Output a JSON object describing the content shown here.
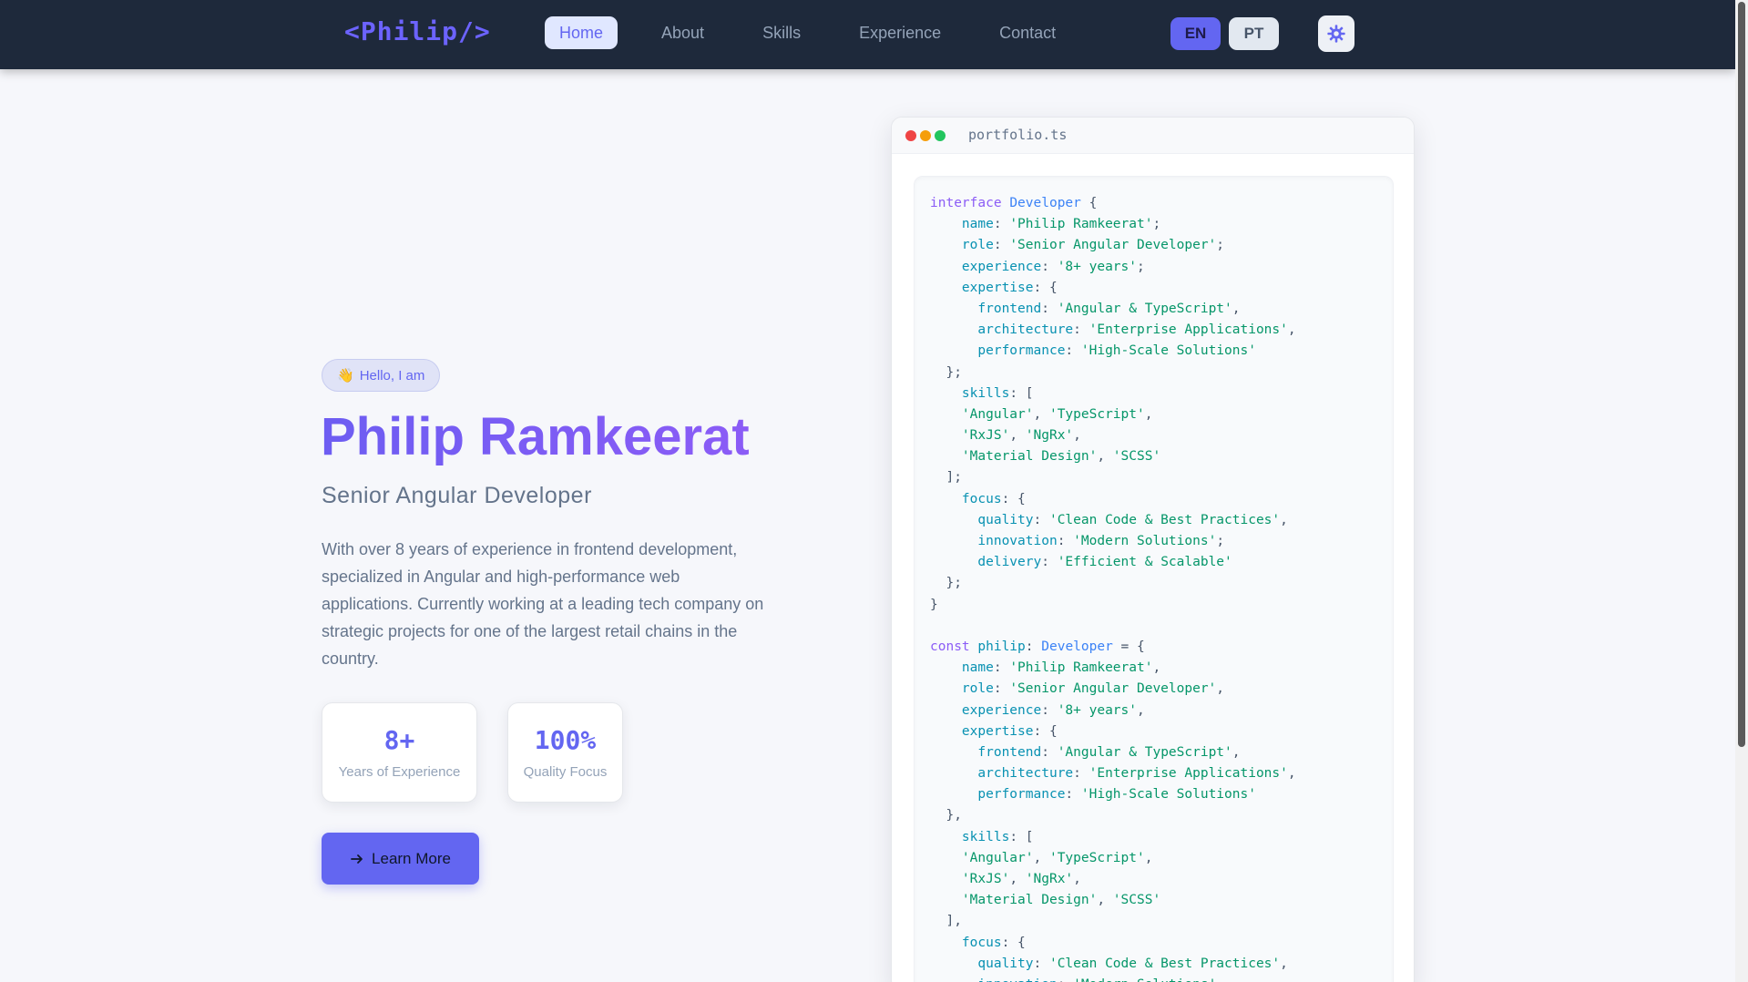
{
  "nav": {
    "logo": "<Philip/>",
    "links": [
      "Home",
      "About",
      "Skills",
      "Experience",
      "Contact"
    ],
    "lang_en": "EN",
    "lang_pt": "PT",
    "theme_icon": "gear-icon"
  },
  "hero": {
    "badge": "Hello, I am",
    "badge_icon": "👋",
    "name": "Philip Ramkeerat",
    "role": "Senior Angular Developer",
    "description": "With over 8 years of experience in frontend development, specialized in Angular and high-performance web applications. Currently working at a leading tech company on strategic projects for one of the largest retail chains in the country.",
    "stats": [
      {
        "value": "8+",
        "label": "Years of Experience"
      },
      {
        "value": "100%",
        "label": "Quality Focus"
      }
    ],
    "cta": "Learn More"
  },
  "code": {
    "filename": "portfolio.ts",
    "lines": [
      [
        [
          "kw",
          "interface "
        ],
        [
          "ty",
          "Developer"
        ],
        [
          "pn",
          " {"
        ]
      ],
      [
        [
          "pn",
          "    "
        ],
        [
          "pr",
          "name"
        ],
        [
          "pn",
          ": "
        ],
        [
          "st",
          "'Philip Ramkeerat'"
        ],
        [
          "pn",
          ";"
        ]
      ],
      [
        [
          "pn",
          "    "
        ],
        [
          "pr",
          "role"
        ],
        [
          "pn",
          ": "
        ],
        [
          "st",
          "'Senior Angular Developer'"
        ],
        [
          "pn",
          ";"
        ]
      ],
      [
        [
          "pn",
          "    "
        ],
        [
          "pr",
          "experience"
        ],
        [
          "pn",
          ": "
        ],
        [
          "st",
          "'8+ years'"
        ],
        [
          "pn",
          ";"
        ]
      ],
      [
        [
          "pn",
          "    "
        ],
        [
          "pr",
          "expertise"
        ],
        [
          "pn",
          ": {"
        ]
      ],
      [
        [
          "pn",
          "      "
        ],
        [
          "pr",
          "frontend"
        ],
        [
          "pn",
          ": "
        ],
        [
          "st",
          "'Angular & TypeScript'"
        ],
        [
          "pn",
          ","
        ]
      ],
      [
        [
          "pn",
          "      "
        ],
        [
          "pr",
          "architecture"
        ],
        [
          "pn",
          ": "
        ],
        [
          "st",
          "'Enterprise Applications'"
        ],
        [
          "pn",
          ","
        ]
      ],
      [
        [
          "pn",
          "      "
        ],
        [
          "pr",
          "performance"
        ],
        [
          "pn",
          ": "
        ],
        [
          "st",
          "'High-Scale Solutions'"
        ]
      ],
      [
        [
          "pn",
          "  };"
        ]
      ],
      [
        [
          "pn",
          "    "
        ],
        [
          "pr",
          "skills"
        ],
        [
          "pn",
          ": ["
        ]
      ],
      [
        [
          "pn",
          "    "
        ],
        [
          "st",
          "'Angular'"
        ],
        [
          "pn",
          ", "
        ],
        [
          "st",
          "'TypeScript'"
        ],
        [
          "pn",
          ","
        ]
      ],
      [
        [
          "pn",
          "    "
        ],
        [
          "st",
          "'RxJS'"
        ],
        [
          "pn",
          ", "
        ],
        [
          "st",
          "'NgRx'"
        ],
        [
          "pn",
          ","
        ]
      ],
      [
        [
          "pn",
          "    "
        ],
        [
          "st",
          "'Material Design'"
        ],
        [
          "pn",
          ", "
        ],
        [
          "st",
          "'SCSS'"
        ]
      ],
      [
        [
          "pn",
          "  ];"
        ]
      ],
      [
        [
          "pn",
          "    "
        ],
        [
          "pr",
          "focus"
        ],
        [
          "pn",
          ": {"
        ]
      ],
      [
        [
          "pn",
          "      "
        ],
        [
          "pr",
          "quality"
        ],
        [
          "pn",
          ": "
        ],
        [
          "st",
          "'Clean Code & Best Practices'"
        ],
        [
          "pn",
          ","
        ]
      ],
      [
        [
          "pn",
          "      "
        ],
        [
          "pr",
          "innovation"
        ],
        [
          "pn",
          ": "
        ],
        [
          "st",
          "'Modern Solutions'"
        ],
        [
          "pn",
          ";"
        ]
      ],
      [
        [
          "pn",
          "      "
        ],
        [
          "pr",
          "delivery"
        ],
        [
          "pn",
          ": "
        ],
        [
          "st",
          "'Efficient & Scalable'"
        ]
      ],
      [
        [
          "pn",
          "  };"
        ]
      ],
      [
        [
          "pn",
          "}"
        ]
      ],
      [],
      [
        [
          "kw",
          "const "
        ],
        [
          "pr",
          "philip"
        ],
        [
          "pn",
          ": "
        ],
        [
          "ty",
          "Developer"
        ],
        [
          "pn",
          " = {"
        ]
      ],
      [
        [
          "pn",
          "    "
        ],
        [
          "pr",
          "name"
        ],
        [
          "pn",
          ": "
        ],
        [
          "st",
          "'Philip Ramkeerat'"
        ],
        [
          "pn",
          ","
        ]
      ],
      [
        [
          "pn",
          "    "
        ],
        [
          "pr",
          "role"
        ],
        [
          "pn",
          ": "
        ],
        [
          "st",
          "'Senior Angular Developer'"
        ],
        [
          "pn",
          ","
        ]
      ],
      [
        [
          "pn",
          "    "
        ],
        [
          "pr",
          "experience"
        ],
        [
          "pn",
          ": "
        ],
        [
          "st",
          "'8+ years'"
        ],
        [
          "pn",
          ","
        ]
      ],
      [
        [
          "pn",
          "    "
        ],
        [
          "pr",
          "expertise"
        ],
        [
          "pn",
          ": {"
        ]
      ],
      [
        [
          "pn",
          "      "
        ],
        [
          "pr",
          "frontend"
        ],
        [
          "pn",
          ": "
        ],
        [
          "st",
          "'Angular & TypeScript'"
        ],
        [
          "pn",
          ","
        ]
      ],
      [
        [
          "pn",
          "      "
        ],
        [
          "pr",
          "architecture"
        ],
        [
          "pn",
          ": "
        ],
        [
          "st",
          "'Enterprise Applications'"
        ],
        [
          "pn",
          ","
        ]
      ],
      [
        [
          "pn",
          "      "
        ],
        [
          "pr",
          "performance"
        ],
        [
          "pn",
          ": "
        ],
        [
          "st",
          "'High-Scale Solutions'"
        ]
      ],
      [
        [
          "pn",
          "  },"
        ]
      ],
      [
        [
          "pn",
          "    "
        ],
        [
          "pr",
          "skills"
        ],
        [
          "pn",
          ": ["
        ]
      ],
      [
        [
          "pn",
          "    "
        ],
        [
          "st",
          "'Angular'"
        ],
        [
          "pn",
          ", "
        ],
        [
          "st",
          "'TypeScript'"
        ],
        [
          "pn",
          ","
        ]
      ],
      [
        [
          "pn",
          "    "
        ],
        [
          "st",
          "'RxJS'"
        ],
        [
          "pn",
          ", "
        ],
        [
          "st",
          "'NgRx'"
        ],
        [
          "pn",
          ","
        ]
      ],
      [
        [
          "pn",
          "    "
        ],
        [
          "st",
          "'Material Design'"
        ],
        [
          "pn",
          ", "
        ],
        [
          "st",
          "'SCSS'"
        ]
      ],
      [
        [
          "pn",
          "  ],"
        ]
      ],
      [
        [
          "pn",
          "    "
        ],
        [
          "pr",
          "focus"
        ],
        [
          "pn",
          ": {"
        ]
      ],
      [
        [
          "pn",
          "      "
        ],
        [
          "pr",
          "quality"
        ],
        [
          "pn",
          ": "
        ],
        [
          "st",
          "'Clean Code & Best Practices'"
        ],
        [
          "pn",
          ","
        ]
      ],
      [
        [
          "pn",
          "      "
        ],
        [
          "pr",
          "innovation"
        ],
        [
          "pn",
          ": "
        ],
        [
          "st",
          "'Modern Solutions'"
        ],
        [
          "pn",
          ","
        ]
      ]
    ]
  },
  "colors": {
    "accent": "#6366f1",
    "nav_bg": "#1e293b",
    "name_gradient": [
      "#6d5df2",
      "#8b5cf6"
    ]
  }
}
